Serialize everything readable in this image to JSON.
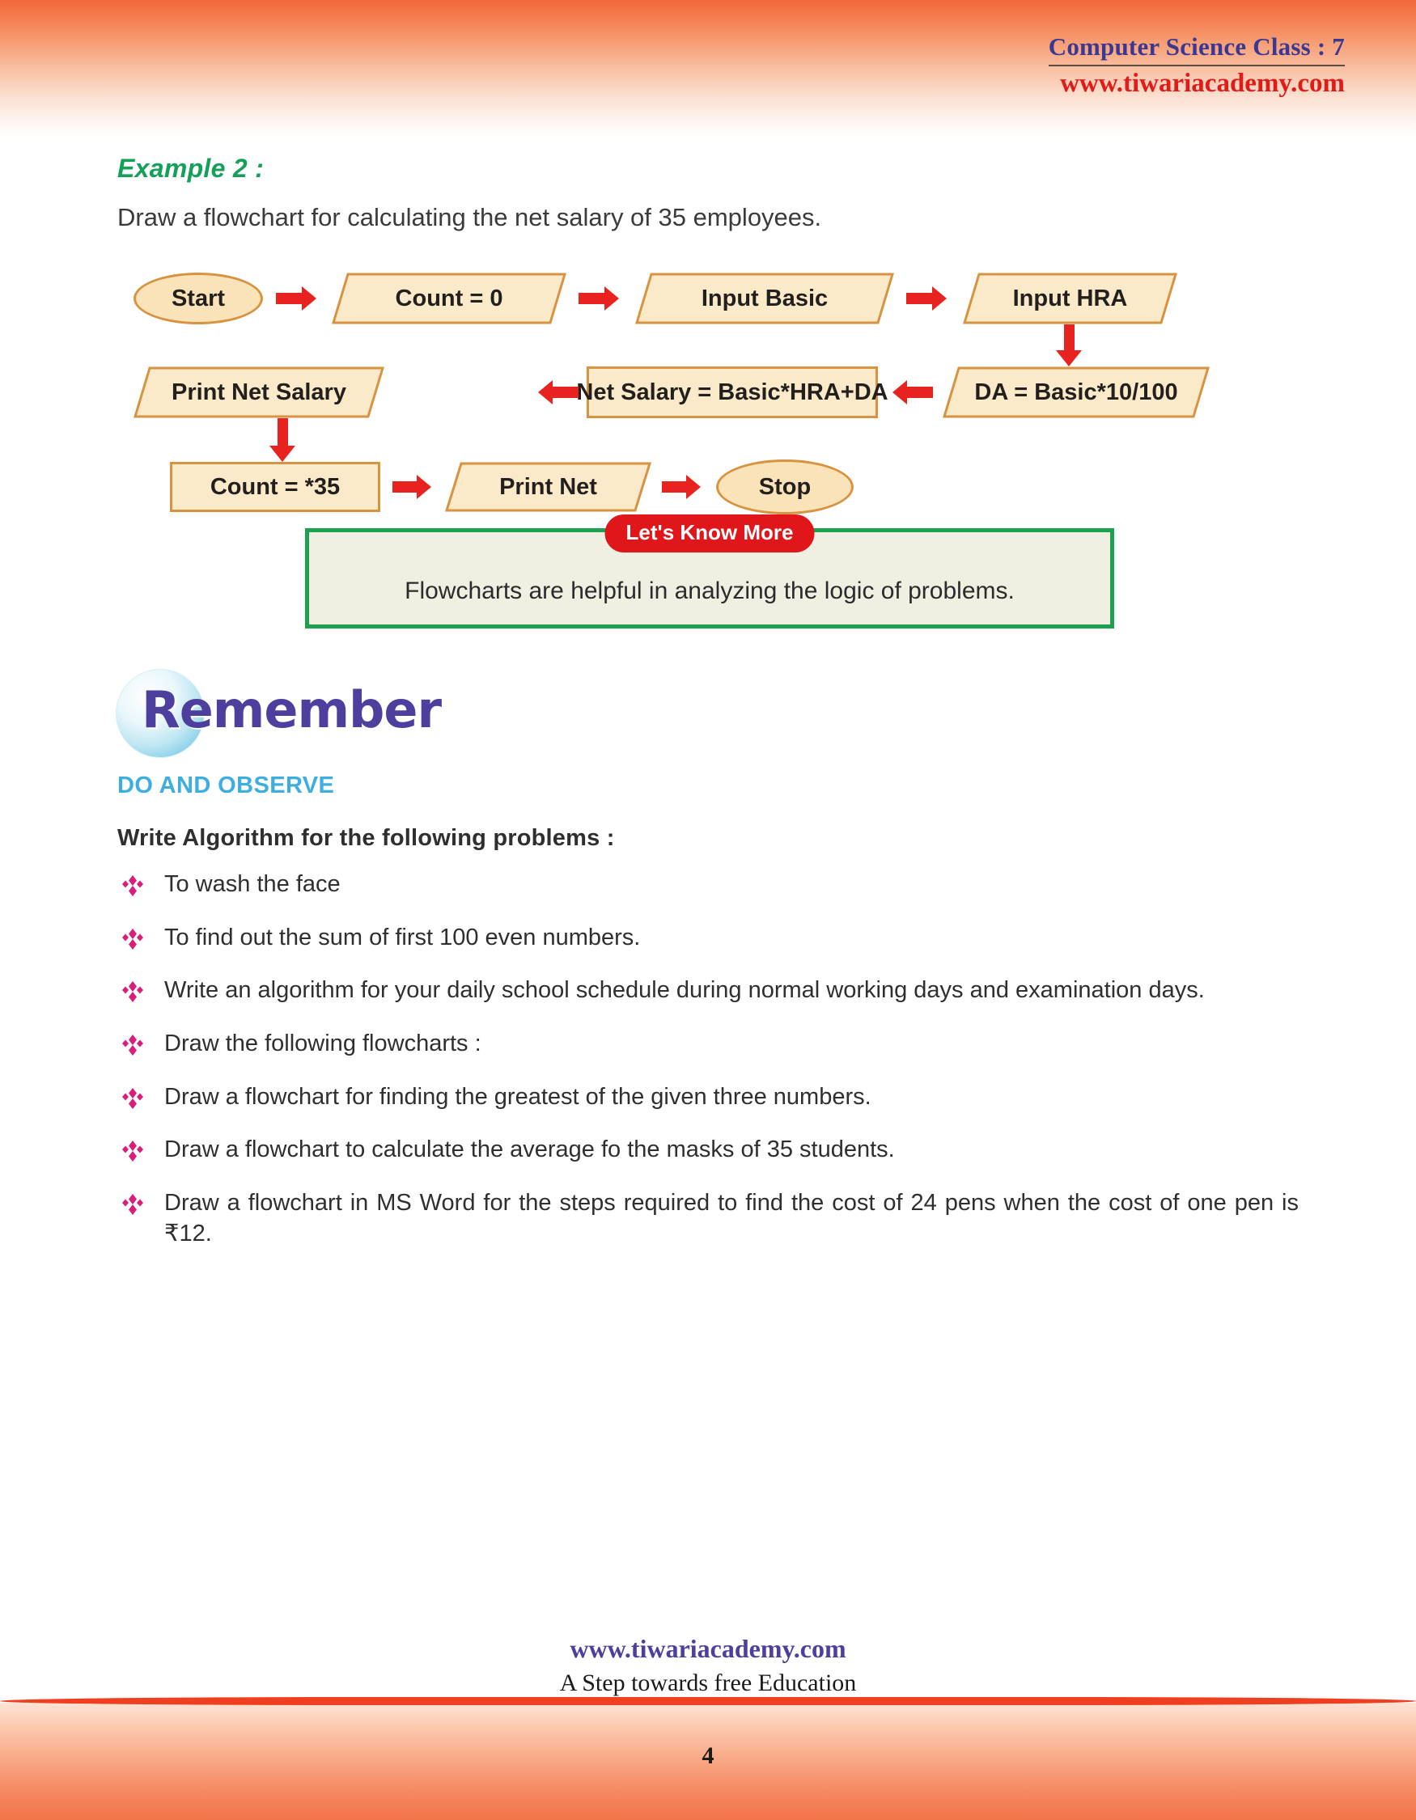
{
  "header": {
    "title": "Computer Science Class : 7",
    "url": "www.tiwariacademy.com"
  },
  "example": {
    "label": "Example 2 :",
    "description": "Draw a flowchart for calculating the net salary of 35 employees."
  },
  "flowchart": {
    "nodes": [
      {
        "id": "start",
        "label": "Start",
        "shape": "ellipse"
      },
      {
        "id": "count0",
        "label": "Count = 0",
        "shape": "parallelogram"
      },
      {
        "id": "inputbasic",
        "label": "Input Basic",
        "shape": "parallelogram"
      },
      {
        "id": "inputhra",
        "label": "Input HRA",
        "shape": "parallelogram"
      },
      {
        "id": "da",
        "label": "DA = Basic*10/100",
        "shape": "parallelogram"
      },
      {
        "id": "netsalary",
        "label": "Net Salary = Basic*HRA+DA",
        "shape": "rectangle"
      },
      {
        "id": "printnet",
        "label": "Print Net Salary",
        "shape": "parallelogram"
      },
      {
        "id": "count35",
        "label": "Count = *35",
        "shape": "rectangle"
      },
      {
        "id": "printnet2",
        "label": "Print Net",
        "shape": "parallelogram"
      },
      {
        "id": "stop",
        "label": "Stop",
        "shape": "ellipse"
      }
    ],
    "shape_fill": "#fbeaca",
    "shape_border": "#d89340",
    "arrow_color": "#e8221f"
  },
  "know_more": {
    "badge": "Let's Know More",
    "text": "Flowcharts are helpful in analyzing the logic of problems.",
    "border_color": "#1ca14e",
    "badge_color": "#e0161b"
  },
  "remember": {
    "title": "Remember",
    "subtitle": "DO AND OBSERVE",
    "heading": "Write Algorithm for the following problems :"
  },
  "tasks": [
    "To wash the face",
    "To find out the sum of first 100 even numbers.",
    "Write an algorithm for your daily school schedule during normal working days and examination days.",
    "Draw the following flowcharts :",
    "Draw a flowchart for finding the greatest of the given three numbers.",
    "Draw a flowchart to calculate the average fo the masks of 35 students.",
    "Draw a flowchart in MS Word for the steps required to find the cost of 24 pens when the cost of one pen is ₹12."
  ],
  "footer": {
    "site": "www.tiwariacademy.com",
    "tagline": "A Step towards free Education",
    "page_number": "4"
  }
}
